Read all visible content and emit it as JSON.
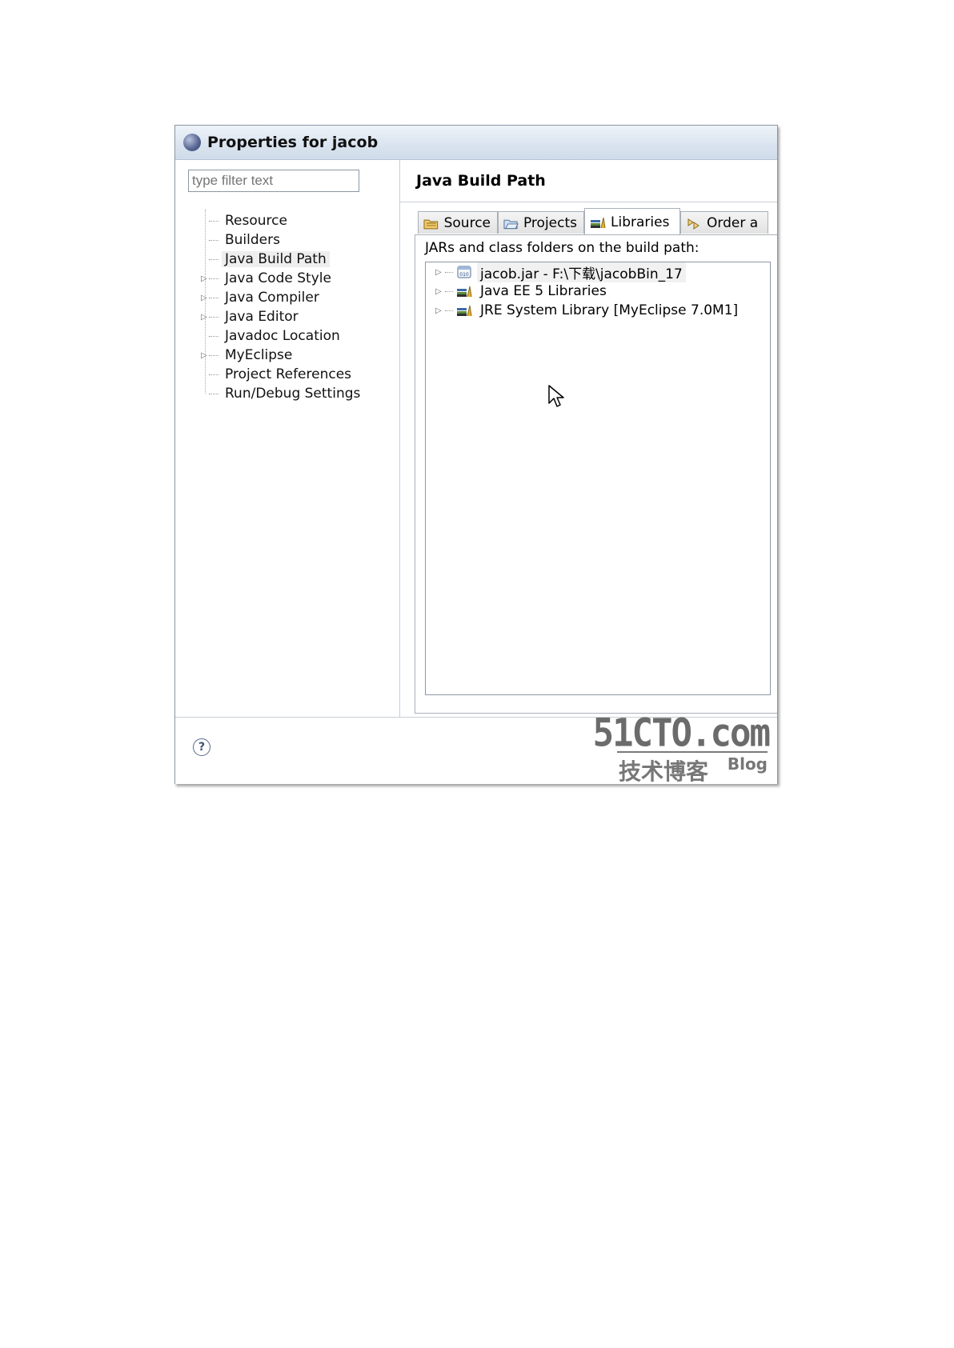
{
  "window": {
    "title": "Properties for jacob"
  },
  "left_panel": {
    "filter_placeholder": "type filter text",
    "tree": [
      {
        "label": "Resource",
        "expandable": false
      },
      {
        "label": "Builders",
        "expandable": false
      },
      {
        "label": "Java Build Path",
        "expandable": false,
        "selected": true
      },
      {
        "label": "Java Code Style",
        "expandable": true
      },
      {
        "label": "Java Compiler",
        "expandable": true
      },
      {
        "label": "Java Editor",
        "expandable": true
      },
      {
        "label": "Javadoc Location",
        "expandable": false
      },
      {
        "label": "MyEclipse",
        "expandable": true
      },
      {
        "label": "Project References",
        "expandable": false
      },
      {
        "label": "Run/Debug Settings",
        "expandable": false
      }
    ]
  },
  "right_panel": {
    "header": "Java Build Path",
    "tabs": [
      {
        "label": "Source",
        "icon": "source-folder-icon"
      },
      {
        "label": "Projects",
        "icon": "projects-folder-icon"
      },
      {
        "label": "Libraries",
        "icon": "libraries-icon",
        "active": true
      },
      {
        "label": "Order a",
        "icon": "order-export-icon"
      }
    ],
    "list_label": "JARs and class folders on the build path:",
    "entries": [
      {
        "label": "jacob.jar - F:\\下载\\jacobBin_17",
        "icon": "jar-icon"
      },
      {
        "label": "Java EE 5 Libraries",
        "icon": "library-icon"
      },
      {
        "label": "JRE System Library [MyEclipse 7.0M1]",
        "icon": "library-icon"
      }
    ]
  },
  "footer": {
    "help_symbol": "?"
  },
  "watermark": {
    "line1": "51CTO.com",
    "line2": "技术博客",
    "line3": "Blog"
  }
}
